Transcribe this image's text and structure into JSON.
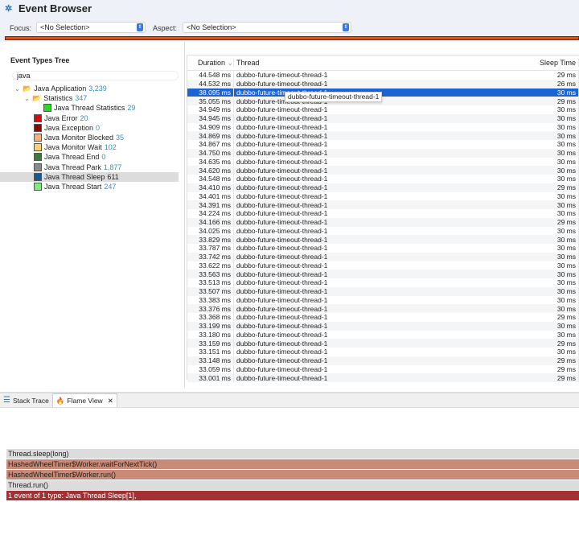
{
  "header": {
    "title": "Event Browser",
    "focus_label": "Focus:",
    "focus_value": "<No Selection>",
    "aspect_label": "Aspect:",
    "aspect_value": "<No Selection>"
  },
  "tree": {
    "title": "Event Types Tree",
    "search_value": "java",
    "items": [
      {
        "label": "Java Application",
        "count": "3,239",
        "color": "folder"
      },
      {
        "label": "Statistics",
        "count": "347",
        "color": "folder"
      },
      {
        "label": "Java Thread Statistics",
        "count": "29",
        "color": "#22dd22"
      },
      {
        "label": "Java Error",
        "count": "20",
        "color": "#d01010"
      },
      {
        "label": "Java Exception",
        "count": "0",
        "color": "#8a0a0a"
      },
      {
        "label": "Java Monitor Blocked",
        "count": "35",
        "color": "#f4b080"
      },
      {
        "label": "Java Monitor Wait",
        "count": "102",
        "color": "#f8d070"
      },
      {
        "label": "Java Thread End",
        "count": "0",
        "color": "#3a7a3a"
      },
      {
        "label": "Java Thread Park",
        "count": "1,877",
        "color": "#8a8a8a"
      },
      {
        "label": "Java Thread Sleep",
        "count": "611",
        "color": "#1a5a8a"
      },
      {
        "label": "Java Thread Start",
        "count": "247",
        "color": "#7af07a"
      }
    ]
  },
  "table": {
    "columns": [
      "Duration",
      "Thread",
      "Sleep Time"
    ],
    "tooltip": "dubbo-future-timeout-thread-1",
    "selected_index": 2,
    "rows": [
      [
        "44.548 ms",
        "dubbo-future-timeout-thread-1",
        "29 ms"
      ],
      [
        "44.532 ms",
        "dubbo-future-timeout-thread-1",
        "26 ms"
      ],
      [
        "38.095 ms",
        "dubbo-future-timeout-thread-1",
        "30 ms"
      ],
      [
        "35.055 ms",
        "dubbo-future-timeout-thread-1",
        "29 ms"
      ],
      [
        "34.949 ms",
        "dubbo-future-timeout-thread-1",
        "30 ms"
      ],
      [
        "34.945 ms",
        "dubbo-future-timeout-thread-1",
        "30 ms"
      ],
      [
        "34.909 ms",
        "dubbo-future-timeout-thread-1",
        "30 ms"
      ],
      [
        "34.869 ms",
        "dubbo-future-timeout-thread-1",
        "30 ms"
      ],
      [
        "34.867 ms",
        "dubbo-future-timeout-thread-1",
        "30 ms"
      ],
      [
        "34.750 ms",
        "dubbo-future-timeout-thread-1",
        "30 ms"
      ],
      [
        "34.635 ms",
        "dubbo-future-timeout-thread-1",
        "30 ms"
      ],
      [
        "34.620 ms",
        "dubbo-future-timeout-thread-1",
        "30 ms"
      ],
      [
        "34.548 ms",
        "dubbo-future-timeout-thread-1",
        "30 ms"
      ],
      [
        "34.410 ms",
        "dubbo-future-timeout-thread-1",
        "29 ms"
      ],
      [
        "34.401 ms",
        "dubbo-future-timeout-thread-1",
        "30 ms"
      ],
      [
        "34.391 ms",
        "dubbo-future-timeout-thread-1",
        "30 ms"
      ],
      [
        "34.224 ms",
        "dubbo-future-timeout-thread-1",
        "30 ms"
      ],
      [
        "34.166 ms",
        "dubbo-future-timeout-thread-1",
        "29 ms"
      ],
      [
        "34.025 ms",
        "dubbo-future-timeout-thread-1",
        "30 ms"
      ],
      [
        "33.829 ms",
        "dubbo-future-timeout-thread-1",
        "30 ms"
      ],
      [
        "33.787 ms",
        "dubbo-future-timeout-thread-1",
        "30 ms"
      ],
      [
        "33.742 ms",
        "dubbo-future-timeout-thread-1",
        "30 ms"
      ],
      [
        "33.622 ms",
        "dubbo-future-timeout-thread-1",
        "30 ms"
      ],
      [
        "33.563 ms",
        "dubbo-future-timeout-thread-1",
        "30 ms"
      ],
      [
        "33.513 ms",
        "dubbo-future-timeout-thread-1",
        "30 ms"
      ],
      [
        "33.507 ms",
        "dubbo-future-timeout-thread-1",
        "30 ms"
      ],
      [
        "33.383 ms",
        "dubbo-future-timeout-thread-1",
        "30 ms"
      ],
      [
        "33.376 ms",
        "dubbo-future-timeout-thread-1",
        "30 ms"
      ],
      [
        "33.368 ms",
        "dubbo-future-timeout-thread-1",
        "29 ms"
      ],
      [
        "33.199 ms",
        "dubbo-future-timeout-thread-1",
        "30 ms"
      ],
      [
        "33.180 ms",
        "dubbo-future-timeout-thread-1",
        "30 ms"
      ],
      [
        "33.159 ms",
        "dubbo-future-timeout-thread-1",
        "29 ms"
      ],
      [
        "33.151 ms",
        "dubbo-future-timeout-thread-1",
        "30 ms"
      ],
      [
        "33.148 ms",
        "dubbo-future-timeout-thread-1",
        "29 ms"
      ],
      [
        "33.059 ms",
        "dubbo-future-timeout-thread-1",
        "29 ms"
      ],
      [
        "33.001 ms",
        "dubbo-future-timeout-thread-1",
        "29 ms"
      ]
    ]
  },
  "bottom": {
    "tabs": [
      "Stack Trace",
      "Flame View"
    ],
    "flame": [
      {
        "label": "Thread.sleep(long)",
        "color": "#dcdcdc",
        "text": "#222"
      },
      {
        "label": "HashedWheelTimer$Worker.waitForNextTick()",
        "color": "#c98b78",
        "text": "#222"
      },
      {
        "label": "HashedWheelTimer$Worker.run()",
        "color": "#c98b78",
        "text": "#222"
      },
      {
        "label": "Thread.run()",
        "color": "#dcdcdc",
        "text": "#222"
      },
      {
        "label": "1 event of 1 type: Java Thread Sleep[1],",
        "color": "#a33034",
        "text": "#fff"
      }
    ]
  }
}
